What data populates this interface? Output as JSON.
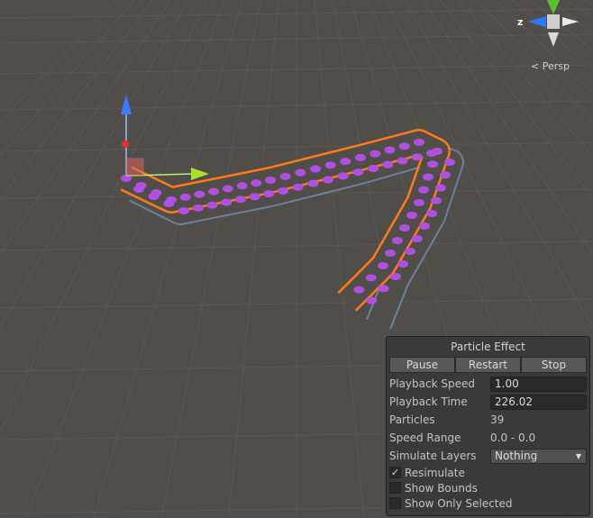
{
  "gizmo": {
    "axis_label": "z",
    "projection": "Persp"
  },
  "panel": {
    "title": "Particle Effect",
    "buttons": [
      "Pause",
      "Restart",
      "Stop"
    ],
    "playback_speed": {
      "label": "Playback Speed",
      "value": "1.00"
    },
    "playback_time": {
      "label": "Playback Time",
      "value": "226.02"
    },
    "particles": {
      "label": "Particles",
      "value": "39"
    },
    "speed_range": {
      "label": "Speed Range",
      "value": "0.0 - 0.0"
    },
    "simulate_layers": {
      "label": "Simulate Layers",
      "value": "Nothing"
    },
    "checkboxes": [
      {
        "label": "Resimulate",
        "checked": true
      },
      {
        "label": "Show Bounds",
        "checked": false
      },
      {
        "label": "Show Only Selected",
        "checked": false
      }
    ]
  },
  "colors": {
    "selection": "#ff7a1a",
    "trail": "#6f87a8",
    "particle": "#b050e0"
  }
}
